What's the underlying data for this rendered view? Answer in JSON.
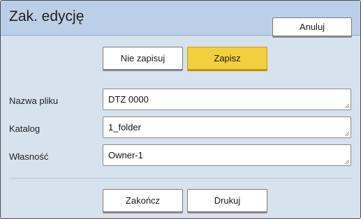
{
  "dialog": {
    "title": "Zak. edycję",
    "cancel_label": "Anuluj"
  },
  "save_choice": {
    "nosave_label": "Nie zapisuj",
    "save_label": "Zapisz"
  },
  "fields": {
    "filename": {
      "label": "Nazwa pliku",
      "value": "DTZ 0000"
    },
    "folder": {
      "label": "Katalog",
      "value": "1_folder"
    },
    "owner": {
      "label": "Własność",
      "value": "Owner-1"
    }
  },
  "footer": {
    "finish_label": "Zakończ",
    "print_label": "Drukuj"
  },
  "colors": {
    "header_bg": "#bccfe8",
    "body_bg": "#d7e2ef",
    "primary_button": "#f2cf3c"
  }
}
